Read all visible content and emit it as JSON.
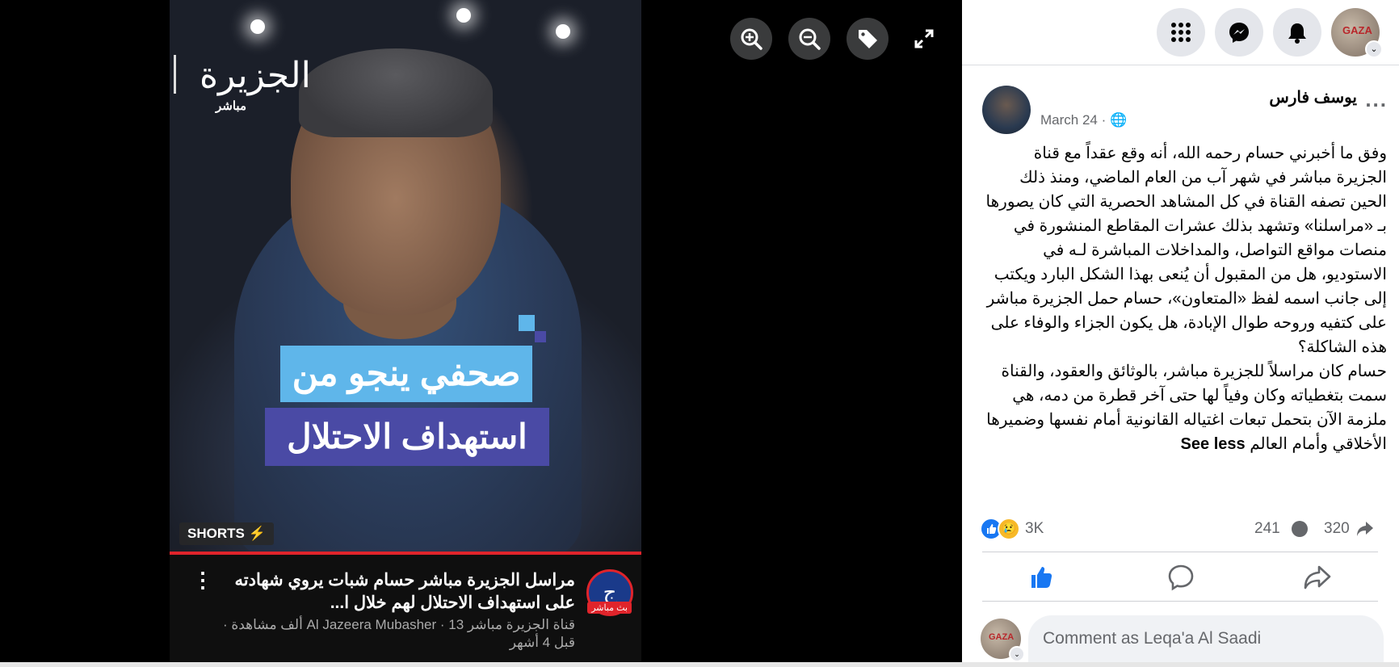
{
  "viewer": {
    "logo_text": "الجزيرة",
    "logo_sub": "مباشر",
    "caption_line1": "صحفي ينجو من",
    "caption_line2": "استهداف الاحتلال",
    "shorts_label": "SHORTS",
    "video_title": "مراسل الجزيرة مباشر حسام شبات يروي شهادته على استهداف الاحتلال لهم خلال ا...",
    "channel_meta": "قناة الجزيرة مباشر Al Jazeera Mubasher · 13 ألف مشاهدة · قبل 4 أشهر",
    "live_badge": "بث مباشر",
    "kebab": "⋮",
    "tools": [
      "zoom-in-icon",
      "zoom-out-icon",
      "tag-icon",
      "fullscreen-icon"
    ]
  },
  "topbar": {
    "icons": [
      "menu-grid-icon",
      "messenger-icon",
      "notifications-icon"
    ],
    "avatar_text": "GAZA",
    "chevron": "⌄"
  },
  "post": {
    "author": "يوسف فارس",
    "more": "...",
    "date": "March 24 · 🌐",
    "paragraph1": "وفق ما أخبرني حسام رحمه الله، أنه وقع عقداً مع قناة الجزيرة مباشر في شهر آب من العام الماضي، ومنذ ذلك الحين تصفه القناة في كل المشاهد الحصرية التي كان يصورها بـ «مراسلنا» وتشهد بذلك عشرات المقاطع المنشورة في منصات مواقع التواصل، والمداخلات المباشرة لـه في الاستوديو، هل من المقبول أن يُنعى بهذا الشكل البارد ويكتب إلى جانب اسمه لفظ «المتعاون»، حسام حمل الجزيرة مباشر على كتفيه وروحه طوال الإبادة، هل يكون الجزاء والوفاء على هذه الشاكلة؟",
    "paragraph2": "حسام كان مراسلاً للجزيرة مباشر، بالوثائق والعقود، والقناة سمت بتغطياته وكان وفياً لها حتى آخر قطرة من دمه، هي ملزمة الآن بتحمل تبعات اغتياله القانونية أمام نفسها وضميرها الأخلاقي وأمام العالم",
    "see_less": "See less"
  },
  "stats": {
    "reactions": "3K",
    "comments": "241",
    "shares": "320",
    "sad_emoji": "😢"
  },
  "comment_box": {
    "placeholder": "Comment as Leqa'a Al Saadi",
    "avatar_text": "GAZA"
  },
  "colors": {
    "accent": "#1877f2",
    "caption_blue": "#5fb6ea",
    "caption_purple": "#4a4aa5",
    "progress_red": "#e0242b"
  }
}
